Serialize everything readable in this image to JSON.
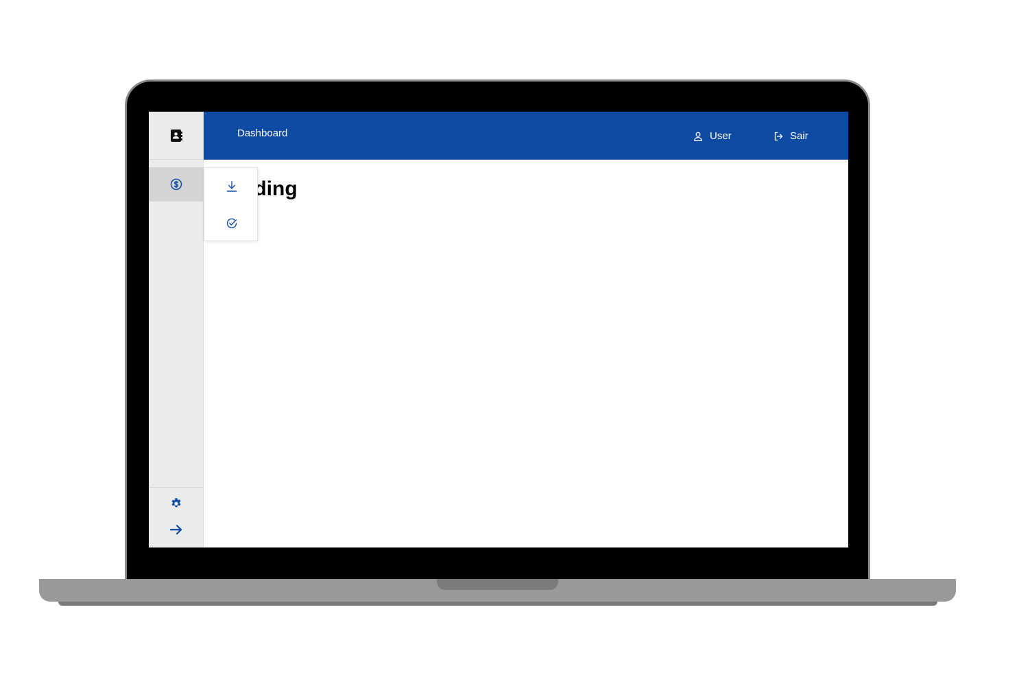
{
  "header": {
    "title": "Dashboard",
    "user_label": "User",
    "logout_label": "Sair"
  },
  "main": {
    "heading": "Loading"
  },
  "colors": {
    "primary": "#0f4aa3",
    "sidebar_bg": "#ebebeb",
    "sidebar_active_bg": "#d4d4d4"
  },
  "icons": {
    "logo": "contact-book-icon",
    "sidebar_finance": "dollar-circle-icon",
    "submenu_download": "download-icon",
    "submenu_check": "check-circle-icon",
    "settings": "gear-icon",
    "expand": "arrow-right-icon",
    "user": "user-icon",
    "logout": "logout-icon"
  }
}
